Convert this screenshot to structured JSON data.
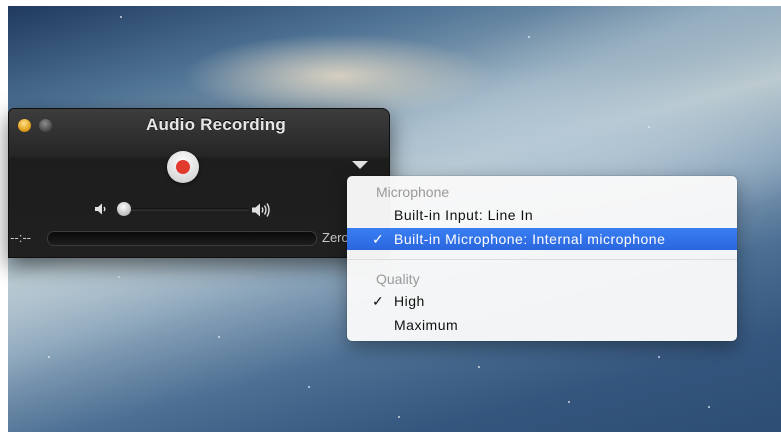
{
  "window": {
    "title": "Audio Recording",
    "time_display": "--:--",
    "size_display": "Zero KB",
    "volume_level": 0.03
  },
  "icons": {
    "record": "record-icon",
    "options": "chevron-down-icon",
    "volume_low": "speaker-low-icon",
    "volume_high": "speaker-high-icon"
  },
  "menu": {
    "microphone_header": "Microphone",
    "microphone_items": [
      {
        "label": "Built-in Input: Line In",
        "checked": false,
        "highlighted": false
      },
      {
        "label": "Built-in Microphone: Internal microphone",
        "checked": true,
        "highlighted": true
      }
    ],
    "quality_header": "Quality",
    "quality_items": [
      {
        "label": "High",
        "checked": true
      },
      {
        "label": "Maximum",
        "checked": false
      }
    ],
    "check_glyph": "✓"
  },
  "colors": {
    "highlight": "#2f6fe8",
    "record_red": "#e23b2e"
  }
}
